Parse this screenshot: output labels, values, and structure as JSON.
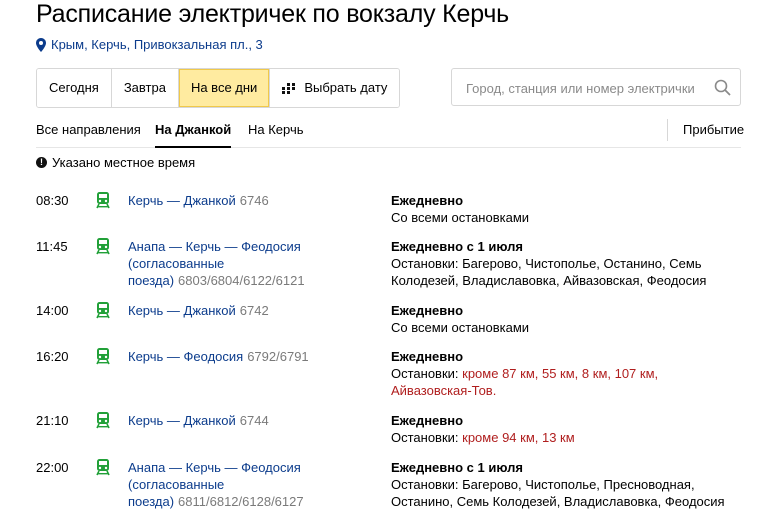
{
  "page": {
    "title": "Расписание электричек по вокзалу Керчь",
    "address": "Крым, Керчь, Привокзальная пл., 3"
  },
  "date_buttons": [
    {
      "label": "Сегодня"
    },
    {
      "label": "Завтра"
    },
    {
      "label": "На все дни",
      "active": true
    },
    {
      "label": "Выбрать дату"
    }
  ],
  "search": {
    "placeholder": "Город, станция или номер электрички"
  },
  "tabs": [
    {
      "label": "Все направления"
    },
    {
      "label": "На Джанкой",
      "active": true
    },
    {
      "label": "На Керчь"
    }
  ],
  "arrival_label": "Прибытие",
  "note": "Указано местное время",
  "colors": {
    "accent_yellow": "#ffeba0",
    "link": "#0c3c8c",
    "train_green": "#21a038",
    "warning_red": "#b01e1e"
  },
  "schedule": [
    {
      "time": "08:30",
      "route_lines": [
        "Керчь — Джанкой"
      ],
      "numbers": "6746",
      "numbers_inline": true,
      "days": "Ежедневно",
      "stops_plain": "Со всеми остановками",
      "stops_except": ""
    },
    {
      "time": "11:45",
      "route_lines": [
        "Анапа — Керчь — Феодосия",
        "(согласованные",
        "поезда)"
      ],
      "numbers": "6803/6804/6122/6121",
      "numbers_inline": true,
      "days": "Ежедневно с 1 июля",
      "stops_plain": "Остановки: Багерово, Чистополье, Останино, Семь Колодезей, Владиславовка, Айвазовская, Феодосия",
      "stops_except": ""
    },
    {
      "time": "14:00",
      "route_lines": [
        "Керчь — Джанкой"
      ],
      "numbers": "6742",
      "numbers_inline": true,
      "days": "Ежедневно",
      "stops_plain": "Со всеми остановками",
      "stops_except": ""
    },
    {
      "time": "16:20",
      "route_lines": [
        "Керчь — Феодосия"
      ],
      "numbers": "6792/6791",
      "numbers_inline": true,
      "days": "Ежедневно",
      "stops_plain": "Остановки: ",
      "stops_except": "кроме 87 км, 55 км, 8 км, 107 км, Айвазовская-Тов."
    },
    {
      "time": "21:10",
      "route_lines": [
        "Керчь — Джанкой"
      ],
      "numbers": "6744",
      "numbers_inline": true,
      "days": "Ежедневно",
      "stops_plain": "Остановки: ",
      "stops_except": "кроме 94 км, 13 км"
    },
    {
      "time": "22:00",
      "route_lines": [
        "Анапа — Керчь — Феодосия",
        "(согласованные",
        "поезда)"
      ],
      "numbers": "6811/6812/6128/6127",
      "numbers_inline": true,
      "days": "Ежедневно с 1 июля",
      "stops_plain": "Остановки: Багерово, Чистополье, Пресноводная, Останино, Семь Колодезей, Владиславовка, Феодосия",
      "stops_except": ""
    }
  ]
}
